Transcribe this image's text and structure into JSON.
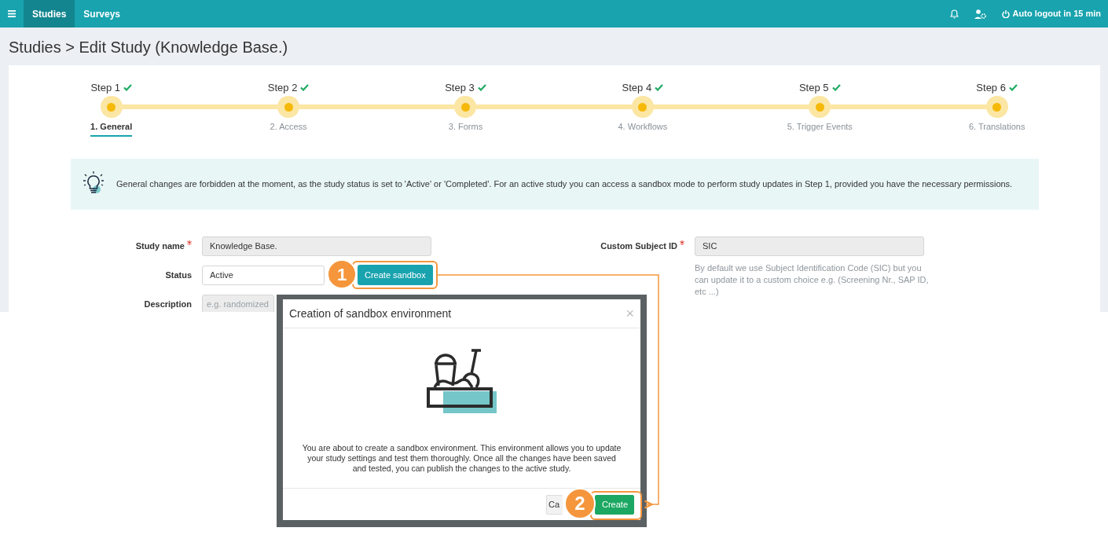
{
  "navbar": {
    "tabs": [
      {
        "label": "Studies",
        "selected": true
      },
      {
        "label": "Surveys",
        "selected": false
      }
    ],
    "logout": "Auto logout in 15 min"
  },
  "page_title": "Studies > Edit Study (Knowledge Base.)",
  "stepper": [
    {
      "step": "Step 1",
      "label": "1. General",
      "done": true,
      "selected": true
    },
    {
      "step": "Step 2",
      "label": "2. Access",
      "done": true,
      "selected": false
    },
    {
      "step": "Step 3",
      "label": "3. Forms",
      "done": true,
      "selected": false
    },
    {
      "step": "Step 4",
      "label": "4. Workflows",
      "done": true,
      "selected": false
    },
    {
      "step": "Step 5",
      "label": "5. Trigger Events",
      "done": true,
      "selected": false
    },
    {
      "step": "Step 6",
      "label": "6. Translations",
      "done": true,
      "selected": false
    }
  ],
  "alert": "General changes are forbidden at the moment, as the study status is set to 'Active' or 'Completed'. For an active study you can access a sandbox mode to perform study updates in Step 1, provided you have the necessary permissions.",
  "left_fields": [
    {
      "label": "Study name",
      "required": true,
      "value": "Knowledge Base.",
      "disabled": true
    },
    {
      "label": "Status",
      "required": false,
      "value": "Active",
      "disabled": false,
      "action": "Create sandbox"
    },
    {
      "label": "Description",
      "required": false,
      "placeholder": "e.g. randomized",
      "disabled": true
    }
  ],
  "right_fields": [
    {
      "label": "Custom Subject ID",
      "required": true,
      "value": "SIC",
      "disabled": true,
      "help": "By default we use Subject Identification Code (SIC) but you can update it to a custom choice e.g. (Screening Nr., SAP ID, etc ...)"
    }
  ],
  "modal": {
    "title": "Creation of sandbox environment",
    "close": "×",
    "text": "You are about to create a sandbox environment. This environment allows you to update your study settings and test them thoroughly. Once all the changes have been saved and tested, you can publish the changes to the active study.",
    "buttons": [
      {
        "label": "Ca",
        "kind": "secondary"
      },
      {
        "label": "Create",
        "kind": "primary"
      }
    ]
  },
  "annotations": [
    {
      "number": "1"
    },
    {
      "number": "2"
    }
  ]
}
